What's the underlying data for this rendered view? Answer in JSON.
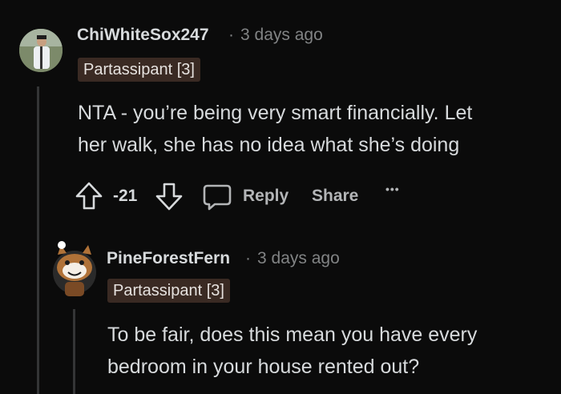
{
  "comments": [
    {
      "username": "ChiWhiteSox247",
      "separator": "·",
      "time": "3 days ago",
      "flair": "Partassipant [3]",
      "body": [
        "NTA - you’re being very smart financially. Let",
        "her walk, she has no idea what she’s doing"
      ],
      "score": "-21",
      "reply_label": "Reply",
      "share_label": "Share",
      "more_label": "•••"
    },
    {
      "username": "PineForestFern",
      "separator": "·",
      "time": "3 days ago",
      "flair": "Partassipant [3]",
      "body": [
        "To be fair, does this mean you have every",
        "bedroom in your house rented out?"
      ]
    }
  ],
  "icons": {
    "upvote": "arrow-up-icon",
    "downvote": "arrow-down-icon",
    "comment": "speech-bubble-icon"
  },
  "colors": {
    "background": "#0b0b0b",
    "flair_bg": "#3a2a23",
    "thread_line": "#343536"
  }
}
